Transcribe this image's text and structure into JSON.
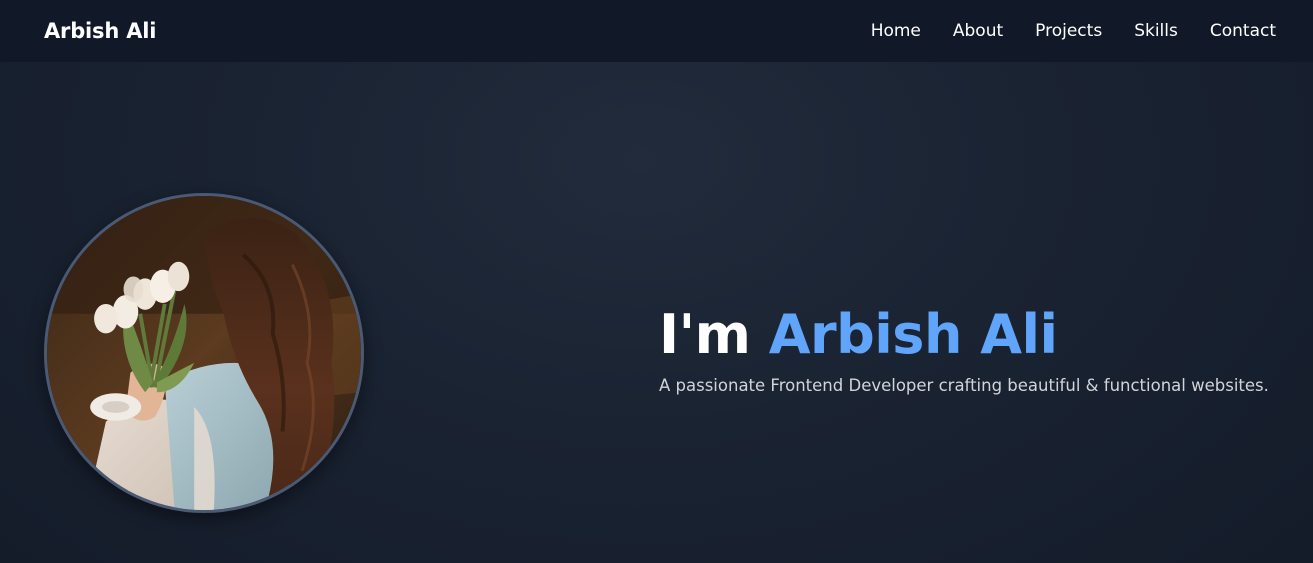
{
  "brand": {
    "name": "Arbish Ali"
  },
  "nav": {
    "links": [
      {
        "label": "Home"
      },
      {
        "label": "About"
      },
      {
        "label": "Projects"
      },
      {
        "label": "Skills"
      },
      {
        "label": "Contact"
      }
    ]
  },
  "hero": {
    "title_prefix": "I'm",
    "title_name": "Arbish Ali",
    "subtitle": "A passionate Frontend Developer crafting beautiful & functional websites."
  },
  "colors": {
    "background": "#1a2332",
    "navbar": "#111827",
    "accent": "#60a5fa",
    "text": "#ffffff",
    "subtitle": "#d1d5db",
    "avatar_border": "#4a5a75"
  }
}
